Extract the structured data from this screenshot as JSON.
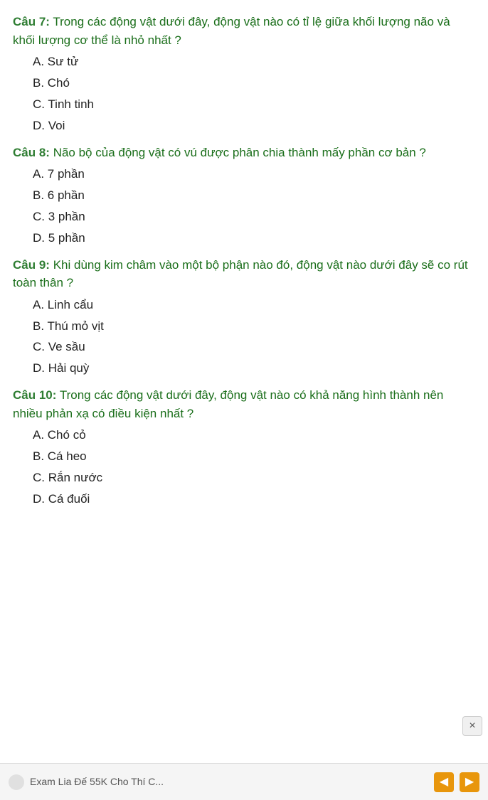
{
  "questions": [
    {
      "id": "q7",
      "label": "Câu 7:",
      "text": " Trong các động vật dưới đây, động vật nào có tỉ lệ giữa khối lượng não và khối lượng cơ thể là nhỏ nhất ?",
      "options": [
        {
          "letter": "A",
          "text": "Sư tử"
        },
        {
          "letter": "B",
          "text": "Chó"
        },
        {
          "letter": "C",
          "text": "Tinh tinh"
        },
        {
          "letter": "D",
          "text": "Voi"
        }
      ]
    },
    {
      "id": "q8",
      "label": "Câu 8:",
      "text": " Não bộ của động vật có vú được phân chia thành mấy phần cơ bản ?",
      "options": [
        {
          "letter": "A",
          "text": "7 phần"
        },
        {
          "letter": "B",
          "text": "6 phần"
        },
        {
          "letter": "C",
          "text": "3 phần"
        },
        {
          "letter": "D",
          "text": "5 phần"
        }
      ]
    },
    {
      "id": "q9",
      "label": "Câu 9:",
      "text": " Khi dùng kim châm vào một bộ phận nào đó, động vật nào dưới đây sẽ co rút toàn thân ?",
      "options": [
        {
          "letter": "A",
          "text": "Linh cẩu"
        },
        {
          "letter": "B",
          "text": "Thú mỏ vịt"
        },
        {
          "letter": "C",
          "text": "Ve sầu"
        },
        {
          "letter": "D",
          "text": "Hải quỳ"
        }
      ]
    },
    {
      "id": "q10",
      "label": "Câu 10:",
      "text": " Trong các động vật dưới đây, động vật nào có khả năng hình thành nên nhiều phản xạ có điều kiện nhất ?",
      "options": [
        {
          "letter": "A",
          "text": "Chó cỏ"
        },
        {
          "letter": "B",
          "text": "Cá heo"
        },
        {
          "letter": "C",
          "text": "Rắn nước"
        },
        {
          "letter": "D",
          "text": "Cá đuối"
        }
      ]
    }
  ],
  "close_label": "×",
  "bottom_bar_text": "Exam Lia Đế 55K Cho Thí C...",
  "nav_prev": "◀",
  "nav_next": "▶"
}
